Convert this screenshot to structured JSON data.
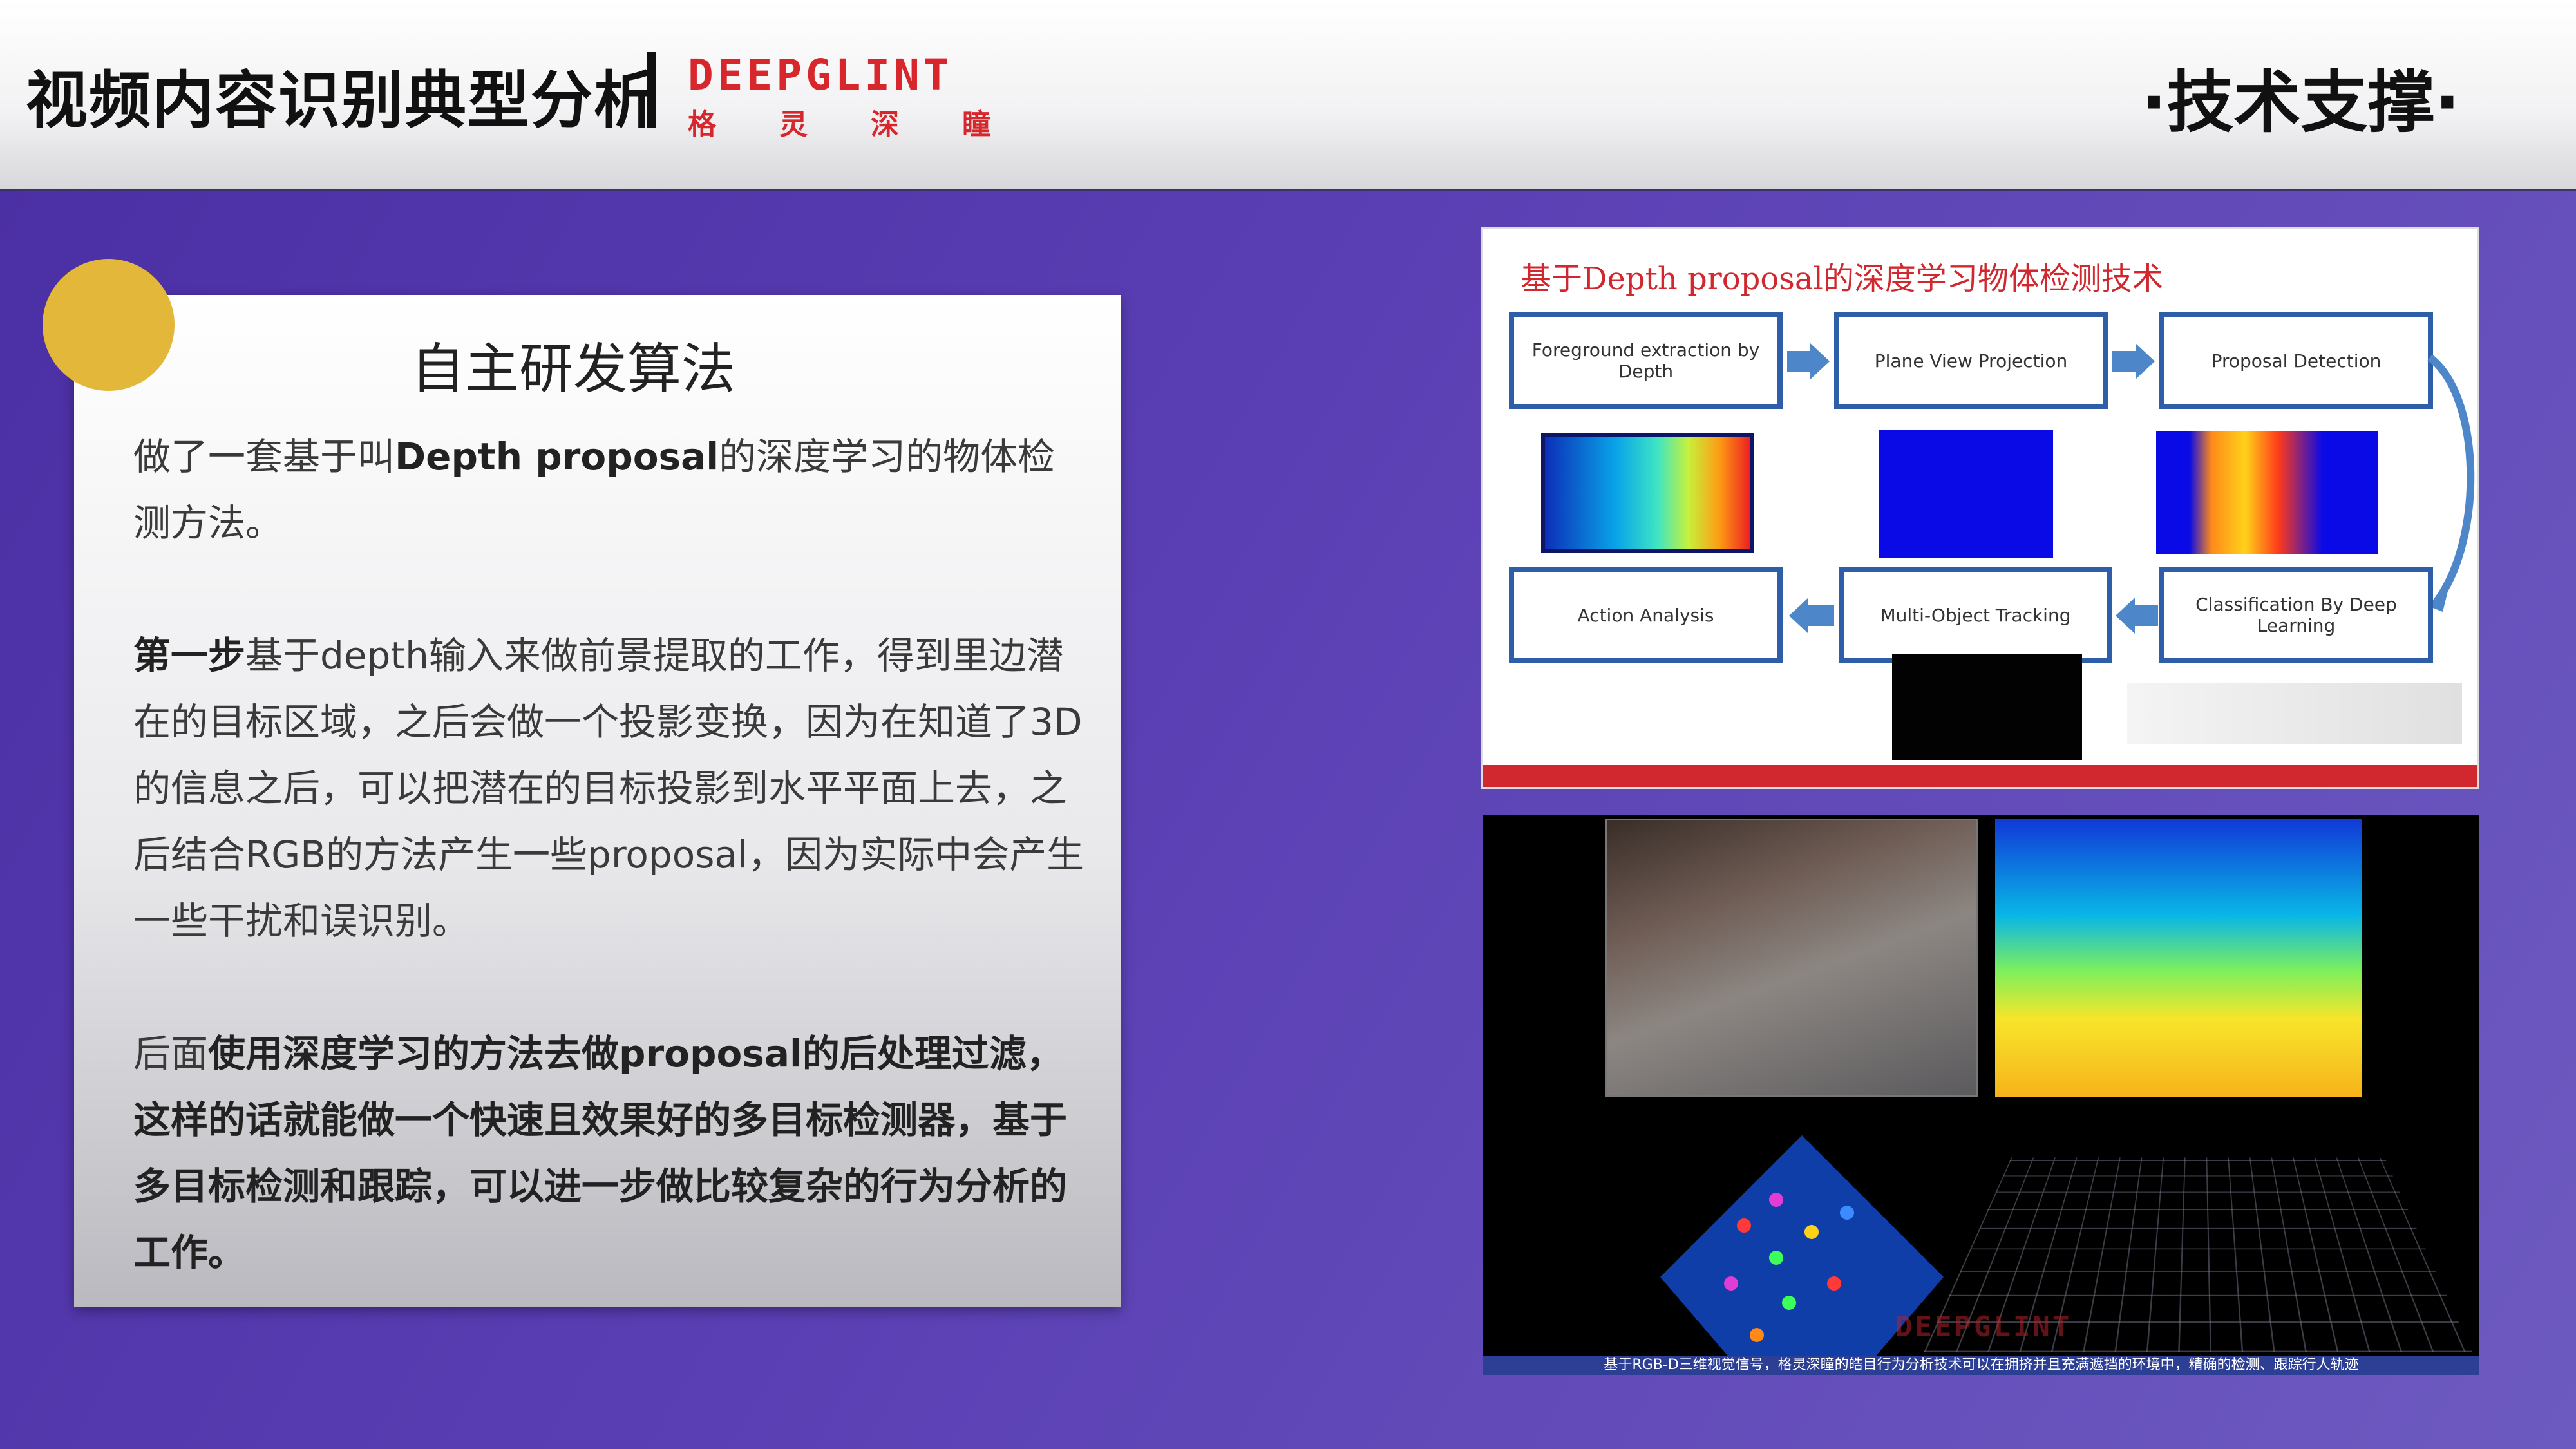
{
  "header": {
    "title": "视频内容识别典型分析",
    "brand_word": "DEEPGLINT",
    "brand_cn": [
      "格",
      "灵",
      "深",
      "瞳"
    ],
    "section": "·技术支撑·"
  },
  "card": {
    "title": "自主研发算法",
    "p1": {
      "a": "做了一套基于叫",
      "b": "Depth proposal",
      "c": "的深度学习的物体检测方法。"
    },
    "p2": {
      "a": "第一步",
      "b": "基于depth输入来做前景提取的工作，得到里边潜在的目标区域，之后会做一个投影变换，因为在知道了3D的信息之后，可以把潜在的目标投影到水平平面上去，之后结合RGB的方法产生一些proposal，因为实际中会产生一些干扰和误识别。"
    },
    "p3": {
      "a": "后面",
      "b": "使用深度学习的方法去做proposal的后处理过滤，这样的话就能做一个快速且效果好的多目标检测器，基于多目标检测和跟踪，可以进一步做比较复杂的行为分析的工作。"
    }
  },
  "figure1": {
    "title": "基于Depth proposal的深度学习物体检测技术",
    "steps": [
      "Foreground extraction by Depth",
      "Plane View Projection",
      "Proposal Detection",
      "Classification By Deep Learning",
      "Multi-Object Tracking",
      "Action Analysis"
    ],
    "colors": {
      "box_border": "#2f5ea9",
      "arrow": "#4d87c9",
      "title": "#d0282e"
    }
  },
  "figure2": {
    "caption": "基于RGB-D三维视觉信号，格灵深瞳的皓目行为分析技术可以在拥挤并且充满遮挡的环境中，精确的检测、跟踪行人轨迹",
    "watermark": "DEEPGLINT"
  }
}
